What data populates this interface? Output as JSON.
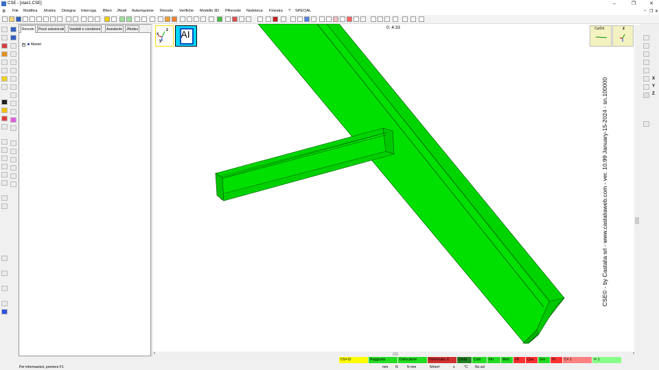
{
  "window": {
    "title": "CSE - [stair1.CSE]",
    "controls": [
      "–",
      "❐",
      "✕"
    ]
  },
  "menu": [
    "File",
    "Modifica",
    "Mostra",
    "Disegna",
    "Interroga",
    "Bfem",
    "JNodi",
    "Automazione",
    "Renodo",
    "Verifiche",
    "Modello 3D",
    "PRenodo",
    "Nodoteca",
    "Finestra",
    "?",
    "SPECIAL"
  ],
  "panel": {
    "tabs": [
      "Renodo",
      "Pezzi selezionati",
      "Variabili e condizioni",
      "Assistente",
      "JNodes"
    ],
    "tree": {
      "expander": "+",
      "root_label": "Master"
    }
  },
  "viewport": {
    "counter": "0: 4:33",
    "axis_widget": {
      "z": "z",
      "x": "x",
      "y": "y"
    },
    "ai_button": "AI",
    "curdir_label": "CurDir",
    "z_label": "z",
    "member_color": "#00e000",
    "version_text": "CSE© - by Castalia srl - www.castaliaweb.com - ver. 10.99 January-15-2024 - sn.100000"
  },
  "right_axes": [
    "X",
    "Y",
    "Z"
  ],
  "status": {
    "message": "Per informazioni, premere F1",
    "cells": [
      {
        "label": "DS=10",
        "color": "#ffff00"
      },
      {
        "label": "Raggiusto",
        "color": "#22dd22"
      },
      {
        "label": "Dislocatore",
        "color": "#22dd22"
      },
      {
        "label": "Deformata: 0",
        "color": "#d03030"
      },
      {
        "label": "Ombr",
        "color": "#208020"
      },
      {
        "label": "Colri",
        "color": "#22dd22"
      },
      {
        "label": "Fin",
        "color": "#22dd22"
      },
      {
        "label": "Med",
        "color": "#22dd22"
      },
      {
        "label": "FB",
        "color": "#ff3030"
      },
      {
        "label": "Quo",
        "color": "#ff3030"
      },
      {
        "label": "Grn",
        "color": "#22dd22"
      },
      {
        "label": "Ht",
        "color": "#ff3030"
      },
      {
        "label": "C= 1",
        "color": "#ff8080"
      },
      {
        "label": "I= 1",
        "color": "#88ff88"
      }
    ],
    "units": [
      "mm",
      "N",
      "N mm",
      "N/mm²",
      "s",
      "°C",
      "No sel"
    ]
  }
}
